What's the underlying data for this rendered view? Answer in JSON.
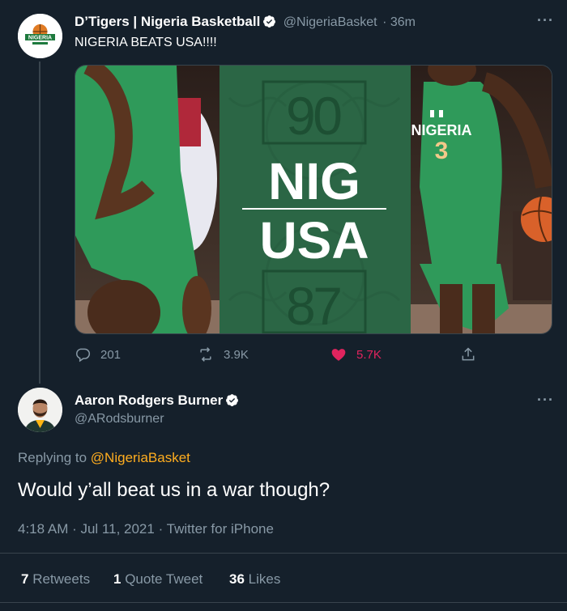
{
  "tweet1": {
    "display_name": "D’Tigers | Nigeria Basketball",
    "handle": "@NigeriaBasket",
    "time": "· 36m",
    "text": "NIGERIA BEATS USA!!!!",
    "avatar_text": "NIGERIA",
    "media": {
      "score_top": "90",
      "team_top": "NIG",
      "team_bottom": "USA",
      "score_bottom": "87",
      "jersey_name": "NIGERIA",
      "jersey_number": "3"
    },
    "actions": {
      "replies": "201",
      "retweets": "3.9K",
      "likes": "5.7K"
    }
  },
  "tweet2": {
    "display_name": "Aaron Rodgers Burner",
    "handle": "@ARodsburner",
    "replying_prefix": "Replying to",
    "replying_to": "@NigeriaBasket",
    "text": "Would y’all beat us in a war though?",
    "timestamp": "4:18 AM · Jul 11, 2021 · Twitter for iPhone",
    "stats": {
      "retweets_count": "7",
      "retweets_label": "Retweets",
      "quote_count": "1",
      "quote_label": "Quote Tweet",
      "likes_count": "36",
      "likes_label": "Likes"
    }
  },
  "colors": {
    "background": "#15202b",
    "muted": "#8899a6",
    "like": "#e0245e",
    "link": "#ffad1f",
    "green": "#2b6645"
  }
}
